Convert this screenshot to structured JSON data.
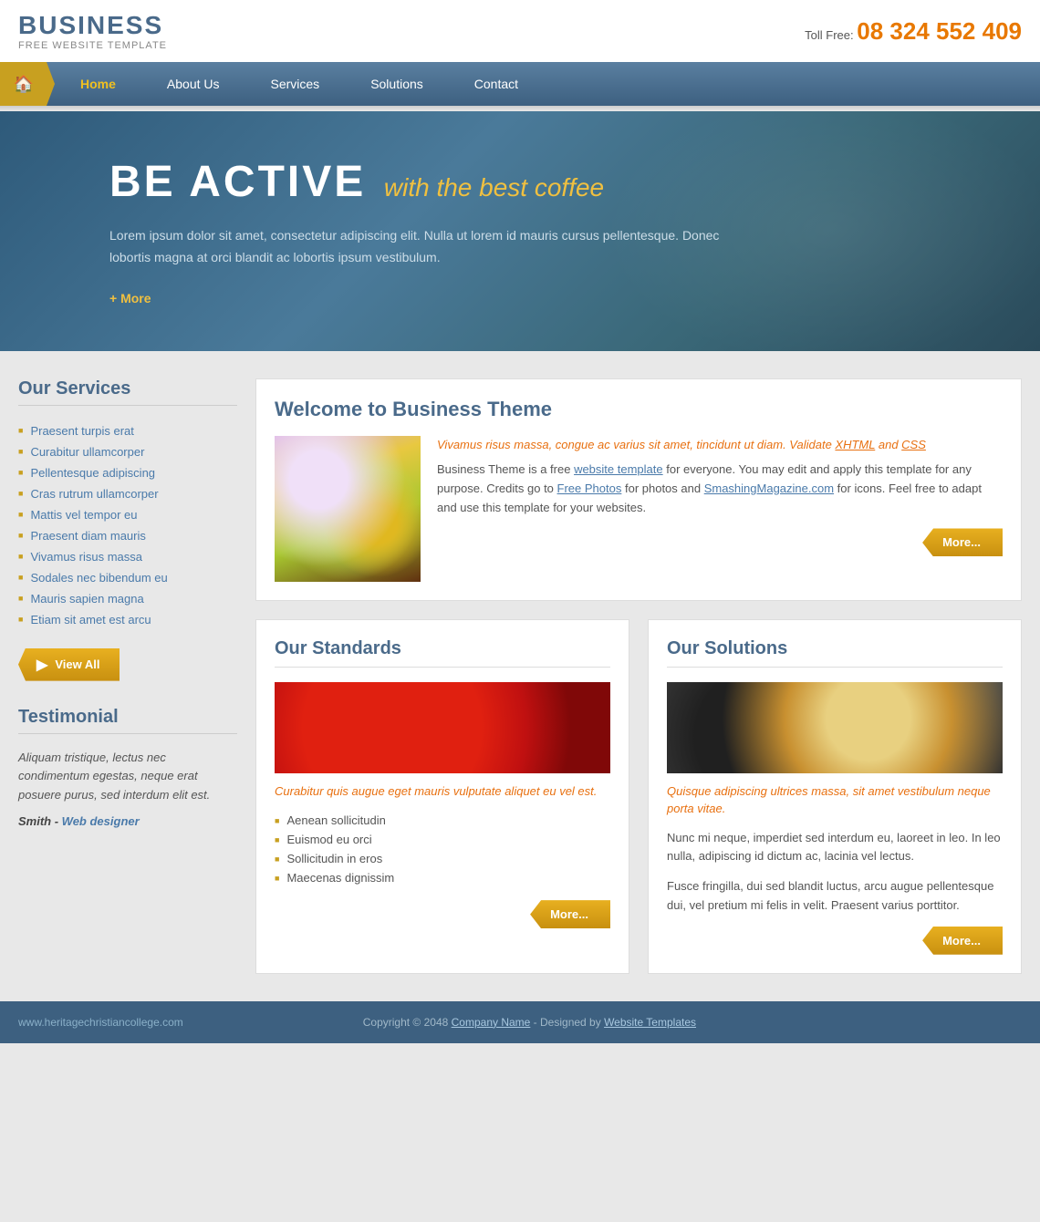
{
  "header": {
    "site_title": "BUSINESS",
    "site_subtitle": "FREE WEBSITE TEMPLATE",
    "toll_free_label": "Toll Free:",
    "toll_free_number": "08 324 552 409"
  },
  "nav": {
    "home_label": "Home",
    "about_label": "About Us",
    "services_label": "Services",
    "solutions_label": "Solutions",
    "contact_label": "Contact"
  },
  "hero": {
    "title_main": "BE ACTIVE",
    "title_sub": "with the best coffee",
    "description": "Lorem ipsum dolor sit amet, consectetur adipiscing elit. Nulla ut lorem id mauris cursus pellentesque. Donec lobortis magna at orci blandit ac lobortis ipsum vestibulum.",
    "more_text": "+ More"
  },
  "sidebar": {
    "services_title": "Our Services",
    "service_items": [
      "Praesent turpis erat",
      "Curabitur ullamcorper",
      "Pellentesque adipiscing",
      "Cras rutrum ullamcorper",
      "Mattis vel tempor eu",
      "Praesent diam mauris",
      "Vivamus risus massa",
      "Sodales nec bibendum eu",
      "Mauris sapien magna",
      "Etiam sit amet est arcu"
    ],
    "view_all_btn": "View All",
    "testimonial_title": "Testimonial",
    "testimonial_text": "Aliquam tristique, lectus nec condimentum egestas, neque erat posuere purus, sed interdum elit est.",
    "testimonial_author": "Smith - ",
    "testimonial_author_link": "Web designer"
  },
  "welcome": {
    "title": "Welcome to Business Theme",
    "italic_text": "Vivamus risus massa, congue ac varius sit amet, tincidunt ut diam. Validate XHTML and CSS",
    "body_text": "Business Theme is a free website template for everyone. You may edit and apply this template for any purpose. Credits go to Free Photos for photos and SmashingMagazine.com for icons. Feel free to adapt and use this template for your websites.",
    "more_btn": "More..."
  },
  "standards": {
    "title": "Our Standards",
    "italic_text": "Curabitur quis augue eget mauris vulputate aliquet eu vel est.",
    "list_items": [
      "Aenean sollicitudin",
      "Euismod eu orci",
      "Sollicitudin in eros",
      "Maecenas dignissim"
    ],
    "more_btn": "More..."
  },
  "solutions": {
    "title": "Our Solutions",
    "italic_text": "Quisque adipiscing ultrices massa, sit amet vestibulum neque porta vitae.",
    "body_text1": "Nunc mi neque, imperdiet sed interdum eu, laoreet in leo. In leo nulla, adipiscing id dictum ac, lacinia vel lectus.",
    "body_text2": "Fusce fringilla, dui sed blandit luctus, arcu augue pellentesque dui, vel pretium mi felis in velit. Praesent varius porttitor.",
    "more_btn": "More..."
  },
  "footer": {
    "url": "www.heritagechristiancollege.com",
    "copyright": "Copyright © 2048 ",
    "company_link": "Company Name",
    "designed_by": " - Designed by ",
    "template_link": "Website Templates"
  }
}
